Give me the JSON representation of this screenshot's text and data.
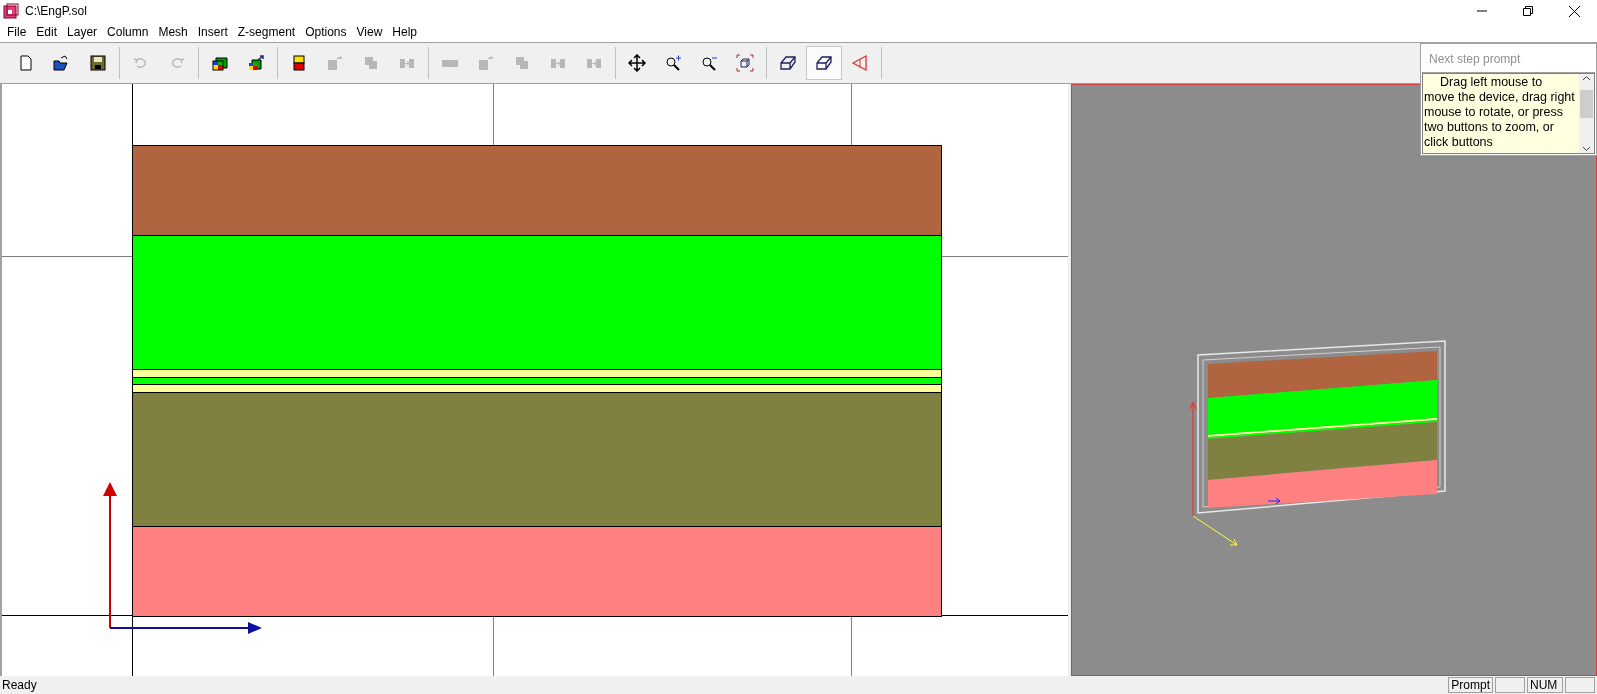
{
  "window": {
    "title": "C:\\EngP.sol"
  },
  "menu": [
    "File",
    "Edit",
    "Layer",
    "Column",
    "Mesh",
    "Insert",
    "Z-segment",
    "Options",
    "View",
    "Help"
  ],
  "toolbar": [
    {
      "kind": "new",
      "disabled": false,
      "selected": false
    },
    {
      "kind": "open",
      "disabled": false,
      "selected": false
    },
    {
      "kind": "save",
      "disabled": false,
      "selected": false
    },
    {
      "kind": "sep"
    },
    {
      "kind": "undo",
      "disabled": true,
      "selected": false
    },
    {
      "kind": "redo",
      "disabled": true,
      "selected": false
    },
    {
      "kind": "sep"
    },
    {
      "kind": "cube",
      "disabled": false,
      "selected": false
    },
    {
      "kind": "cubearrow",
      "disabled": false,
      "selected": false
    },
    {
      "kind": "sep"
    },
    {
      "kind": "layer",
      "disabled": false,
      "selected": false
    },
    {
      "kind": "shapearrow",
      "disabled": true,
      "selected": false
    },
    {
      "kind": "squares",
      "disabled": true,
      "selected": false
    },
    {
      "kind": "split",
      "disabled": true,
      "selected": false
    },
    {
      "kind": "sep"
    },
    {
      "kind": "bar",
      "disabled": true,
      "selected": false
    },
    {
      "kind": "shapearrow",
      "disabled": true,
      "selected": false
    },
    {
      "kind": "squares",
      "disabled": true,
      "selected": false
    },
    {
      "kind": "split",
      "disabled": true,
      "selected": false
    },
    {
      "kind": "split",
      "disabled": true,
      "selected": false
    },
    {
      "kind": "sep"
    },
    {
      "kind": "move",
      "disabled": false,
      "selected": false
    },
    {
      "kind": "zoomin",
      "disabled": false,
      "selected": false
    },
    {
      "kind": "zoomout",
      "disabled": false,
      "selected": false
    },
    {
      "kind": "fit",
      "disabled": false,
      "selected": false
    },
    {
      "kind": "sep"
    },
    {
      "kind": "box",
      "disabled": false,
      "selected": false
    },
    {
      "kind": "box",
      "disabled": false,
      "selected": true
    },
    {
      "kind": "triangle",
      "disabled": false,
      "selected": false
    },
    {
      "kind": "sep"
    }
  ],
  "prompt": {
    "placeholder": "Next step prompt",
    "message": "Drag left mouse to move the device, drag right mouse to rotate, or press two buttons to zoom, or click buttons"
  },
  "layers": [
    {
      "color": "#b0643f"
    },
    {
      "color": "#00ff00"
    },
    {
      "color": "#ffff99"
    },
    {
      "color": "#00ff00"
    },
    {
      "color": "#ffff99"
    },
    {
      "color": "#808040"
    },
    {
      "color": "#ff8080"
    }
  ],
  "status_bar": {
    "message": "Ready",
    "panes": [
      {
        "text": "Prompt"
      },
      {
        "text": "NUM"
      }
    ]
  }
}
